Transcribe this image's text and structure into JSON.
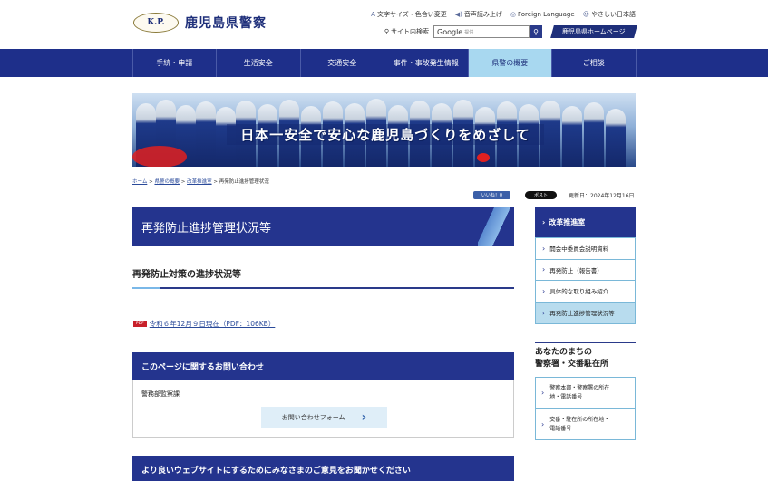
{
  "header": {
    "logo_emblem": "K.P.",
    "site_title": "鹿児島県警察",
    "utility_links": [
      {
        "icon": "text-size-icon",
        "glyph": "A",
        "label": "文字サイズ・色合い変更"
      },
      {
        "icon": "speaker-icon",
        "glyph": "◀)",
        "label": "音声読み上げ"
      },
      {
        "icon": "globe-icon",
        "glyph": "◎",
        "label": "Foreign Language"
      },
      {
        "icon": "smile-icon",
        "glyph": "☺",
        "label": "やさしい日本語"
      }
    ],
    "search_label": "サイト内検索",
    "search_placeholder": "Google",
    "search_sub": "提供",
    "pref_link": "鹿児島県ホームページ"
  },
  "nav": {
    "items": [
      "手続・申請",
      "生活安全",
      "交通安全",
      "事件・事故発生情報",
      "県警の概要",
      "ご相談"
    ],
    "active_index": 4
  },
  "banner": {
    "caption": "日本一安全で安心な鹿児島づくりをめざして"
  },
  "breadcrumb": {
    "items": [
      "ホーム",
      "県警の概要",
      "改革推進室"
    ],
    "current": "再発防止進捗管理状況"
  },
  "social": {
    "facebook": "いいね！0",
    "x_post": "ポスト"
  },
  "updated": "更新日：2024年12月16日",
  "main": {
    "title": "再発防止進捗管理状況等",
    "subheading": "再発防止対策の進捗状況等",
    "pdf_badge": "PDF",
    "pdf_link": "令和６年12月９日現在（PDF：106KB）"
  },
  "contact": {
    "heading": "このページに関するお問い合わせ",
    "department": "警務部監察課",
    "button": "お問い合わせフォーム"
  },
  "feedback": {
    "heading": "より良いウェブサイトにするためにみなさまのご意見をお聞かせください"
  },
  "sidebar": {
    "heading": "改革推進室",
    "items": [
      "開会中委員会説明資料",
      "再発防止（報告書）",
      "具体的な取り組み紹介",
      "再発防止進捗管理状況等"
    ],
    "active_index": 3,
    "section2_title_1": "あなたのまちの",
    "section2_title_2": "警察署・交番駐在所",
    "section2_links": [
      {
        "line1": "警察本部・警察署の所在",
        "line2": "地・電話番号"
      },
      {
        "line1": "交番・駐在所の所在地・",
        "line2": "電話番号"
      }
    ]
  },
  "colors": {
    "primary": "#24348e",
    "accent": "#a8d8f0",
    "link": "#2a4a9a",
    "pdf": "#c8202a"
  }
}
